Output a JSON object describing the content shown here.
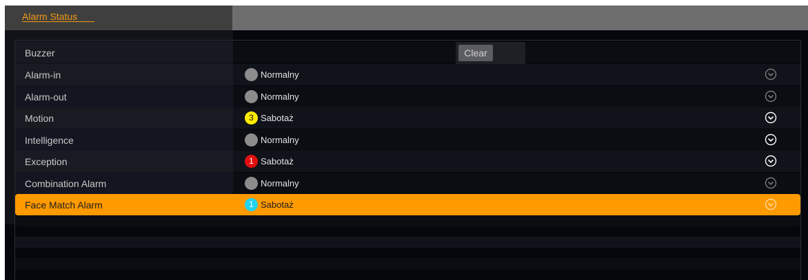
{
  "header": {
    "tab_label": "Alarm Status"
  },
  "buzzer": {
    "label": "Buzzer",
    "clear_label": "Clear"
  },
  "rows": [
    {
      "label": "Alarm-in",
      "status": "Normalny",
      "count": "",
      "dot_color": "#8c8c8c",
      "icon_color": "#7a7a7a"
    },
    {
      "label": "Alarm-out",
      "status": "Normalny",
      "count": "",
      "dot_color": "#8c8c8c",
      "icon_color": "#7a7a7a"
    },
    {
      "label": "Motion",
      "status": "Sabotaż",
      "count": "3",
      "dot_color": "#ffec00",
      "icon_color": "#ffffff"
    },
    {
      "label": "Intelligence",
      "status": "Normalny",
      "count": "",
      "dot_color": "#8c8c8c",
      "icon_color": "#ffffff"
    },
    {
      "label": "Exception",
      "status": "Sabotaż",
      "count": "1",
      "dot_color": "#e01010",
      "icon_color": "#ffffff"
    },
    {
      "label": "Combination Alarm",
      "status": "Normalny",
      "count": "",
      "dot_color": "#8c8c8c",
      "icon_color": "#7a7a7a"
    },
    {
      "label": "Face Match Alarm",
      "status": "Sabotaż",
      "count": "1",
      "dot_color": "#22d3ee",
      "icon_color": "#ffd99a",
      "selected": true
    }
  ]
}
